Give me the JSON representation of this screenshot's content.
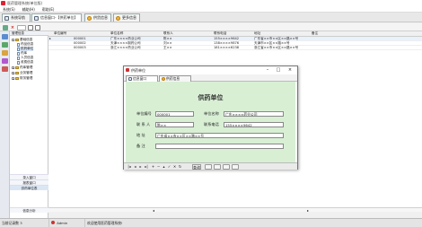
{
  "window": {
    "title": "医药管理系统(单位版)"
  },
  "menu": [
    "系统(S)",
    "辅助(H)",
    "帮助(E)"
  ],
  "tabs": [
    {
      "label": "系统导航"
    },
    {
      "label": "信息窗口-【供药单位】"
    },
    {
      "label": "供货信息"
    },
    {
      "label": "更多信息"
    }
  ],
  "tree": {
    "header": "管理信息",
    "nodes": [
      {
        "label": "基础信息"
      },
      {
        "label": "药品信息"
      },
      {
        "label": "供药单位"
      },
      {
        "label": "药库"
      },
      {
        "label": "人员信息"
      },
      {
        "label": "收费信息"
      },
      {
        "label": "药库管理"
      },
      {
        "label": "业务管理"
      },
      {
        "label": "财务管理"
      }
    ],
    "links": [
      "录入窗口",
      "报表窗口",
      "供药单位表"
    ],
    "bottom": "信息分析"
  },
  "grid": {
    "columns": [
      "单位编号",
      "单位名称",
      "联系人",
      "联系电话",
      "地址",
      "备注"
    ],
    "rows": [
      [
        "000001",
        "广东××××药业公司",
        "陈××",
        "155××××9642",
        "广东省××市××区××路××号",
        ""
      ],
      [
        "000002",
        "天津××××制药公司",
        "刘××",
        "138××××9876",
        "天津市××区××路××号",
        ""
      ],
      [
        "000003",
        "浙江××××药业公司",
        "王××",
        "181××××6238",
        "浙江省××市××区××路××号",
        ""
      ]
    ],
    "footer": [
      "◂",
      "▸"
    ]
  },
  "dialog": {
    "title": "供药单位",
    "tabs": [
      "信息窗口",
      "供药信息"
    ],
    "heading": "供药单位",
    "fields": {
      "code_label": "单位编号",
      "code_value": "000001",
      "name_label": "单位名称",
      "name_value": "广东××××药业公司",
      "contact_label": "联 系 人",
      "contact_value": "陈××",
      "phone_label": "联系电话",
      "phone_value": "155××××9642",
      "addr_label": "地   址",
      "addr_value": "广东省××市××区××路××号",
      "note_label": "备   注",
      "note_value": ""
    },
    "nav": {
      "first": "|◂",
      "prev": "◂",
      "next": "▸",
      "last": "▸|",
      "add": "+",
      "del": "−",
      "edit": "▴",
      "save": "✓",
      "cancel": "✕",
      "refresh": "↻",
      "query": "查询"
    }
  },
  "status": {
    "user_label": "当前记录数",
    "user_value": "3",
    "operator": "Admin",
    "message": "欢迎使用医药管理系统!"
  },
  "colors": {
    "dialog_body": "#d8efd4",
    "selected_row": "#e9f1fb",
    "accent": "#2d6ab0"
  }
}
